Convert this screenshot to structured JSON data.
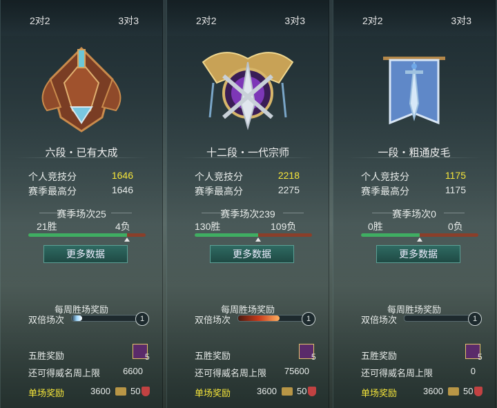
{
  "panels": [
    {
      "tabs": [
        "2对2",
        "3对3"
      ],
      "emblem": "bronze-crest-icon",
      "rank": "六段・已有大成",
      "score_label": "个人竞技分",
      "score": "1646",
      "best_label": "赛季最高分",
      "best": "1646",
      "season": "赛季场次25",
      "wins": "21胜",
      "losses": "4负",
      "win_ratio": 0.84,
      "more": "更多数据",
      "weekly_title": "每周胜场奖励",
      "double_label": "双倍场次",
      "double_count": "1",
      "double_fill": 0.15,
      "five_label": "五胜奖励",
      "chest_count": "5",
      "cap_label": "还可得威名周上限",
      "cap_value": "6600",
      "single_label": "单场奖励",
      "gold": "3600",
      "honor": "50"
    },
    {
      "tabs": [
        "2对2",
        "3对3"
      ],
      "emblem": "purple-winged-crest-icon",
      "rank": "十二段・一代宗师",
      "score_label": "个人竞技分",
      "score": "2218",
      "best_label": "赛季最高分",
      "best": "2275",
      "season": "赛季场次239",
      "wins": "130胜",
      "losses": "109负",
      "win_ratio": 0.54,
      "more": "更多数据",
      "weekly_title": "每周胜场奖励",
      "double_label": "双倍场次",
      "double_count": "1",
      "double_fill": 0.6,
      "five_label": "五胜奖励",
      "chest_count": "5",
      "cap_label": "还可得威名周上限",
      "cap_value": "75600",
      "single_label": "单场奖励",
      "gold": "3600",
      "honor": "50"
    },
    {
      "tabs": [
        "2对2",
        "3对3"
      ],
      "emblem": "blue-banner-sword-icon",
      "rank": "一段・粗通皮毛",
      "score_label": "个人竞技分",
      "score": "1175",
      "best_label": "赛季最高分",
      "best": "1175",
      "season": "赛季场次0",
      "wins": "0胜",
      "losses": "0负",
      "win_ratio": 0.5,
      "more": "更多数据",
      "weekly_title": "每周胜场奖励",
      "double_label": "双倍场次",
      "double_count": "1",
      "double_fill": 0.0,
      "five_label": "五胜奖励",
      "chest_count": "5",
      "cap_label": "还可得威名周上限",
      "cap_value": "0",
      "single_label": "单场奖励",
      "gold": "3600",
      "honor": "50"
    }
  ]
}
